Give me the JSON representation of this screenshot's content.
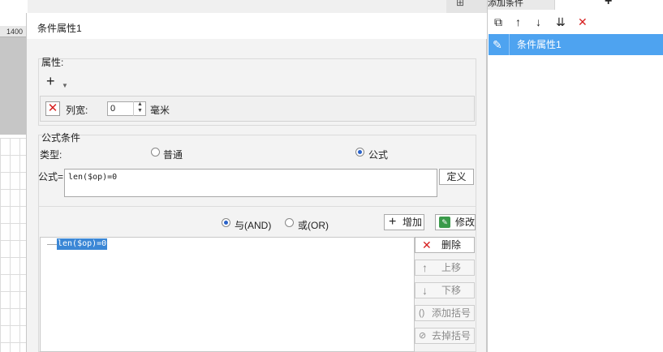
{
  "background": {
    "ruler_tick": "1400"
  },
  "dialog": {
    "title": "条件属性1",
    "attributes": {
      "group_label": "属性:",
      "width_label": "列宽:",
      "width_value": "0",
      "width_unit": "毫米"
    },
    "formula": {
      "group_label": "公式条件",
      "type_label": "类型:",
      "type_normal": "普通",
      "type_formula": "公式",
      "formula_label": "公式=",
      "formula_value": "len($op)=0",
      "define_label": "定义",
      "and_label": "与(AND)",
      "or_label": "或(OR)",
      "add_label": "增加",
      "modify_label": "修改",
      "conditions": [
        "len($op)=0"
      ],
      "delete_label": "删除",
      "up_label": "上移",
      "down_label": "下移",
      "add_paren_label": "添加括号",
      "remove_paren_label": "去掉括号"
    }
  },
  "right_panel": {
    "tab_label": "添加条件",
    "items": [
      "条件属性1"
    ]
  },
  "colors": {
    "selection": "#4ea3f0",
    "tree_selection": "#3b87d6",
    "delete_red": "#d72020"
  }
}
